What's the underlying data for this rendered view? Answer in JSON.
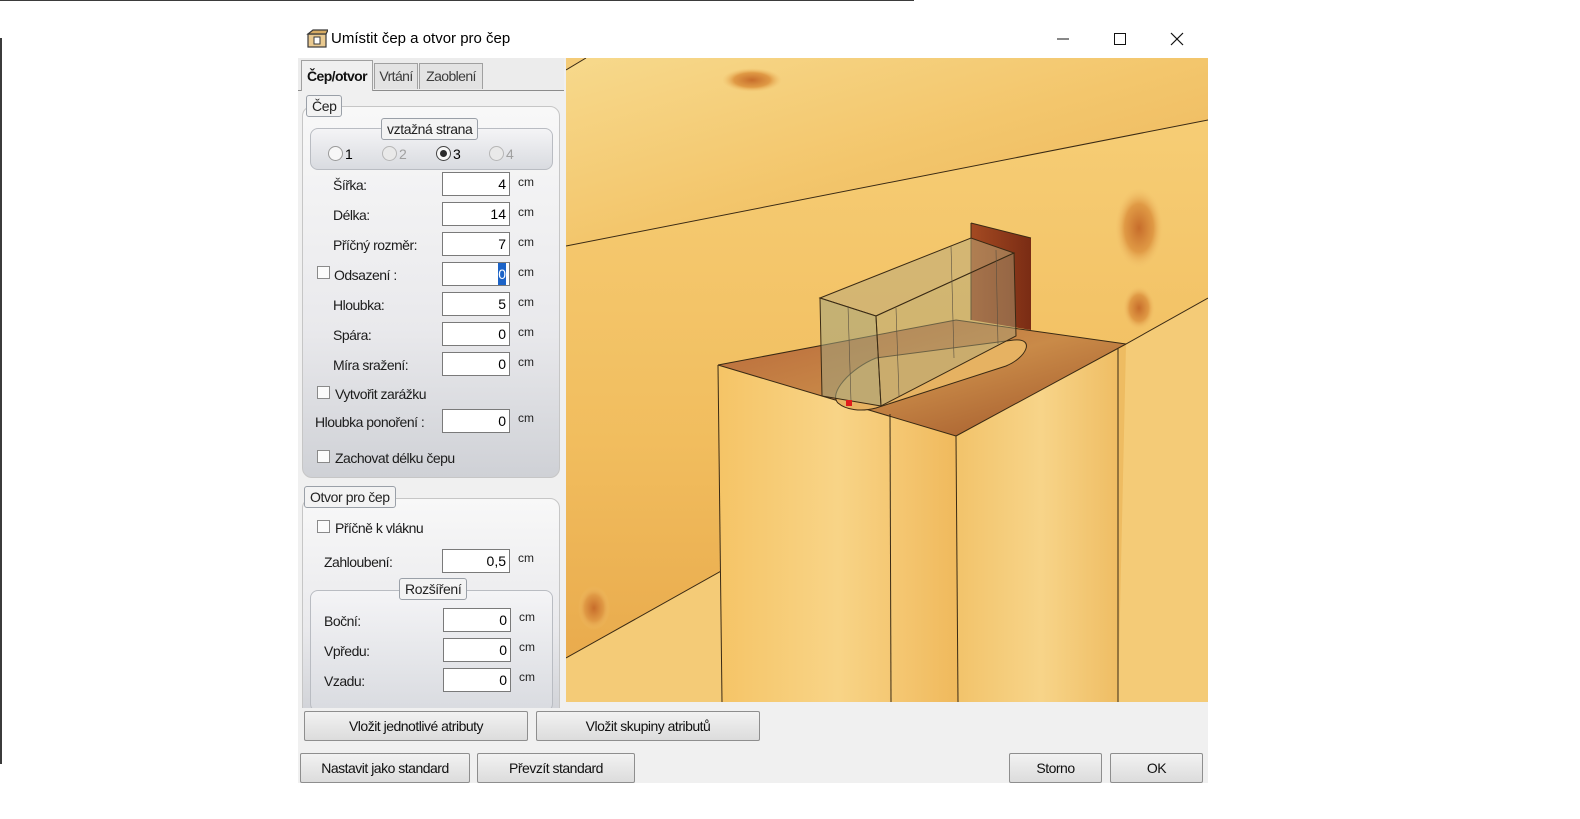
{
  "window": {
    "title": "Umístit čep a otvor pro čep",
    "title_icon": "mortise-tenon-app-icon",
    "controls": [
      "minimize-icon",
      "maximize-icon",
      "close-icon"
    ]
  },
  "tabs": [
    {
      "label": "Čep/otvor",
      "active": true
    },
    {
      "label": "Vrtání",
      "active": false
    },
    {
      "label": "Zaoblení",
      "active": false
    }
  ],
  "tenon": {
    "group_label": "Čep",
    "reference_side": {
      "label": "vztažná strana",
      "options": [
        {
          "label": "1",
          "checked": false,
          "enabled": true
        },
        {
          "label": "2",
          "checked": false,
          "enabled": false
        },
        {
          "label": "3",
          "checked": true,
          "enabled": true
        },
        {
          "label": "4",
          "checked": false,
          "enabled": false
        }
      ]
    },
    "fields": {
      "width": {
        "label": "Šířka:",
        "value": "4",
        "unit": "cm"
      },
      "length": {
        "label": "Délka:",
        "value": "14",
        "unit": "cm"
      },
      "cross": {
        "label": "Příčný rozměr:",
        "value": "7",
        "unit": "cm"
      },
      "offset": {
        "label": "Odsazení :",
        "value": "0",
        "unit": "cm",
        "checked": false
      },
      "depth": {
        "label": "Hloubka:",
        "value": "5",
        "unit": "cm"
      },
      "gap": {
        "label": "Spára:",
        "value": "0",
        "unit": "cm"
      },
      "chamfer": {
        "label": "Míra sražení:",
        "value": "0",
        "unit": "cm"
      },
      "immersion": {
        "label": "Hloubka ponoření :",
        "value": "0",
        "unit": "cm"
      }
    },
    "create_stop": {
      "label": "Vytvořit zarážku",
      "checked": false
    },
    "keep_length": {
      "label": "Zachovat délku čepu",
      "checked": false
    }
  },
  "mortise": {
    "group_label": "Otvor pro čep",
    "cross_grain": {
      "label": "Příčně k vláknu",
      "checked": false
    },
    "recess": {
      "label": "Zahloubení:",
      "value": "0,5",
      "unit": "cm"
    },
    "extension": {
      "label": "Rozšíření",
      "side": {
        "label": "Boční:",
        "value": "0",
        "unit": "cm"
      },
      "front": {
        "label": "Vpředu:",
        "value": "0",
        "unit": "cm"
      },
      "back": {
        "label": "Vzadu:",
        "value": "0",
        "unit": "cm"
      }
    }
  },
  "buttons": {
    "insert_single": "Vložit jednotlivé atributy",
    "insert_groups": "Vložit skupiny atributů",
    "set_standard": "Nastavit jako standard",
    "take_standard": "Převzít standard",
    "cancel": "Storno",
    "ok": "OK"
  },
  "colors": {
    "wood_light": "#f6d27e",
    "wood_mid": "#eebb5f",
    "wood_dark": "#d9973e",
    "end_grain": "#a8582a",
    "tenon_dark": "#8e3a1c",
    "marker": "#e01b1b"
  }
}
